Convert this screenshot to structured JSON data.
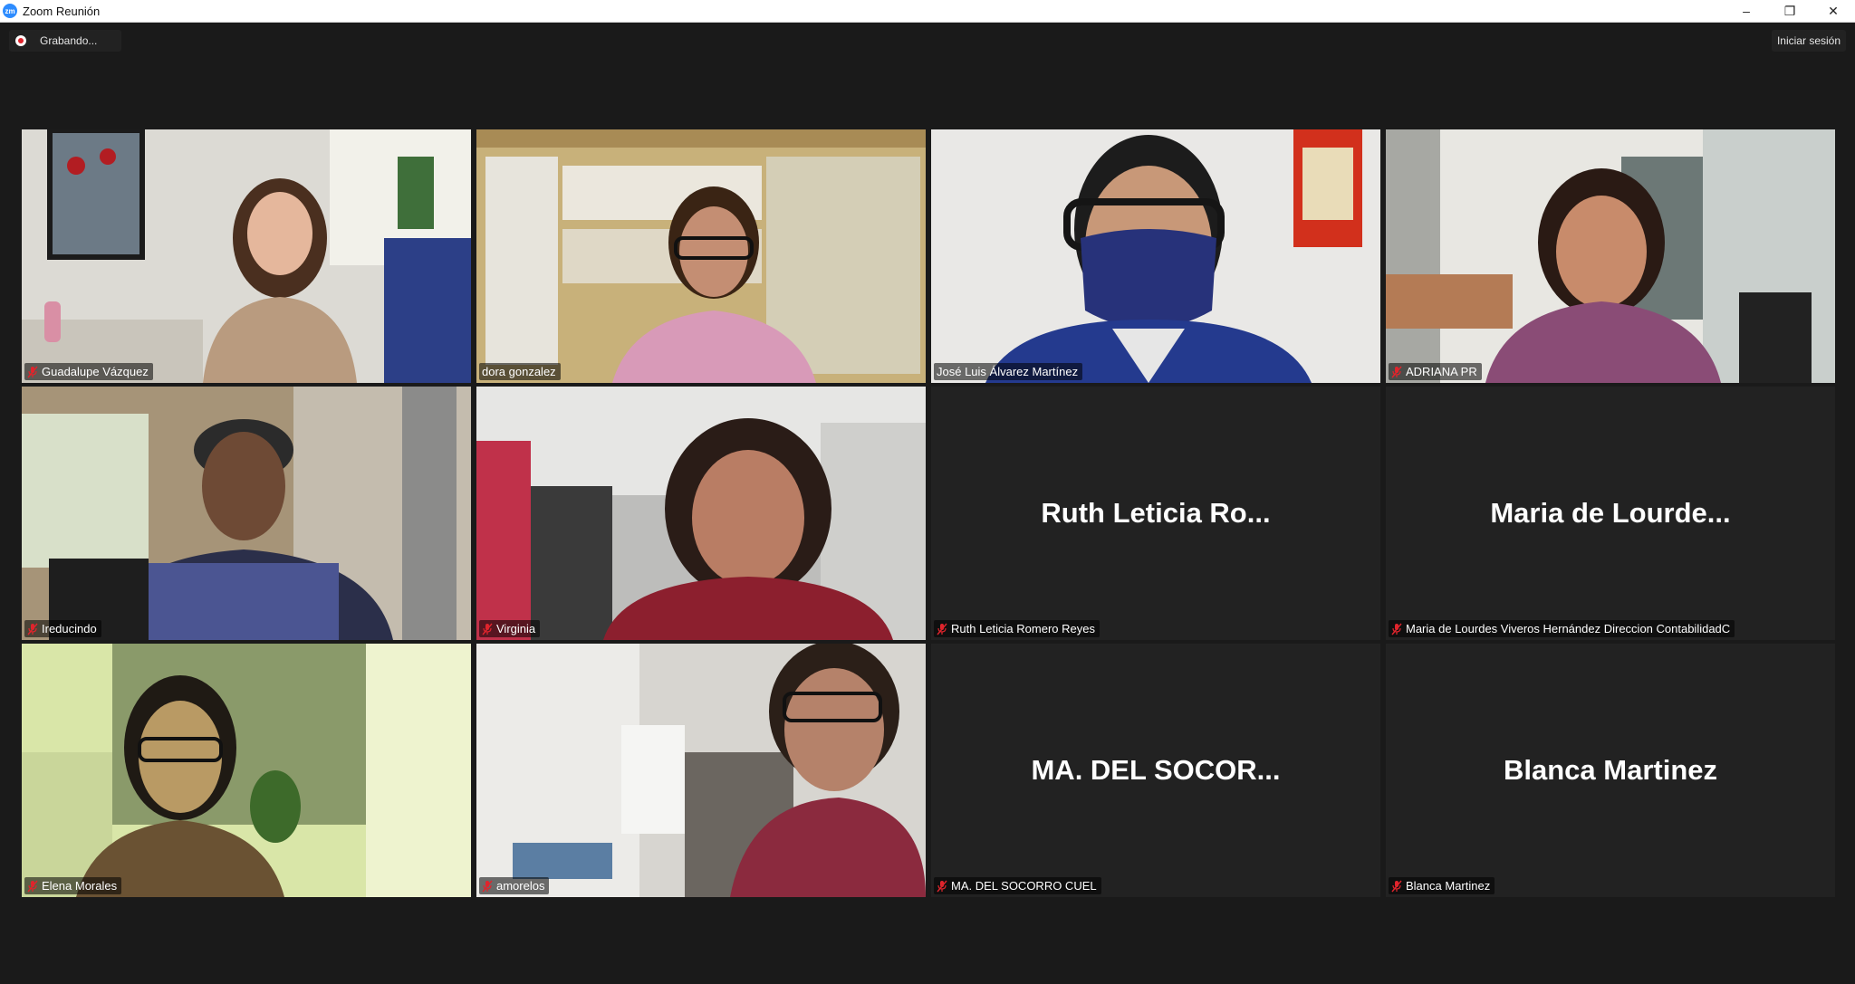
{
  "window": {
    "icon_text": "zm",
    "title": "Zoom Reunión",
    "minimize_glyph": "–",
    "restore_glyph": "❐",
    "close_glyph": "✕"
  },
  "recording": {
    "label": "Grabando..."
  },
  "header": {
    "signin_label": "Iniciar sesión"
  },
  "participants": [
    {
      "name": "Guadalupe Vázquez",
      "muted": true,
      "video": true
    },
    {
      "name": "dora gonzalez",
      "muted": false,
      "video": true
    },
    {
      "name": "José Luis Álvarez Martínez",
      "muted": false,
      "video": true,
      "active_speaker": true
    },
    {
      "name": "ADRIANA PR",
      "muted": true,
      "video": true
    },
    {
      "name": "Ireducindo",
      "muted": true,
      "video": true
    },
    {
      "name": "Virginia",
      "muted": true,
      "video": true
    },
    {
      "name": "Ruth Leticia Romero Reyes",
      "display": "Ruth Leticia Ro...",
      "muted": true,
      "video": false
    },
    {
      "name": "Maria de Lourdes Viveros Hernández Direccion ContabilidadC",
      "display": "Maria de Lourde...",
      "muted": true,
      "video": false
    },
    {
      "name": "Elena Morales",
      "muted": true,
      "video": true
    },
    {
      "name": "amorelos",
      "muted": true,
      "video": true
    },
    {
      "name": "MA. DEL SOCORRO CUEL",
      "display": "MA. DEL SOCOR...",
      "muted": true,
      "video": false
    },
    {
      "name": "Blanca Martinez",
      "display": "Blanca Martinez",
      "muted": true,
      "video": false
    }
  ],
  "colors": {
    "background": "#1a1a1a",
    "tile_off": "#222222",
    "active_border": "#c6e86a",
    "muted_icon": "#e0242c"
  }
}
